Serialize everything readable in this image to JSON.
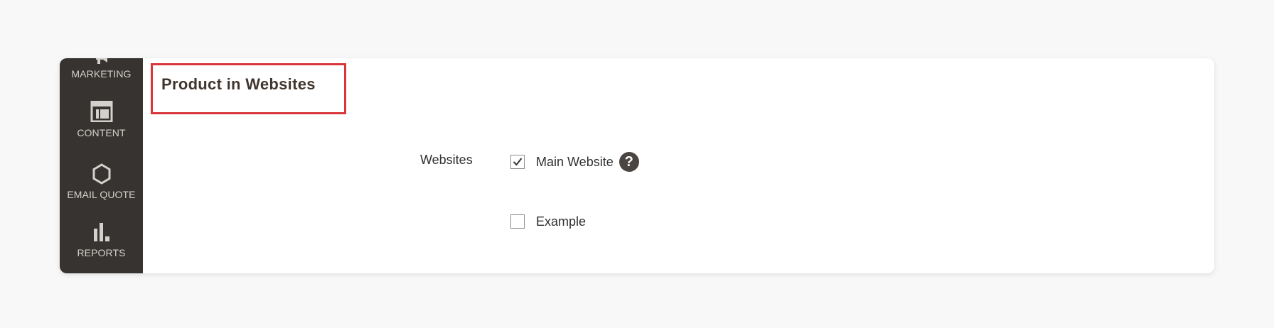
{
  "sidebar": {
    "items": [
      {
        "label": "MARKETING",
        "icon": "megaphone-icon"
      },
      {
        "label": "CONTENT",
        "icon": "layout-icon"
      },
      {
        "label": "EMAIL QUOTE",
        "icon": "hexagon-icon"
      },
      {
        "label": "REPORTS",
        "icon": "bar-chart-icon"
      }
    ],
    "colors": {
      "background": "#373330",
      "text": "#d4d0cc"
    }
  },
  "section": {
    "title": "Product in Websites",
    "highlight_color": "#d9363b"
  },
  "websites": {
    "label": "Websites",
    "options": [
      {
        "label": "Main Website",
        "checked": true,
        "help": "?"
      },
      {
        "label": "Example",
        "checked": false
      }
    ]
  }
}
